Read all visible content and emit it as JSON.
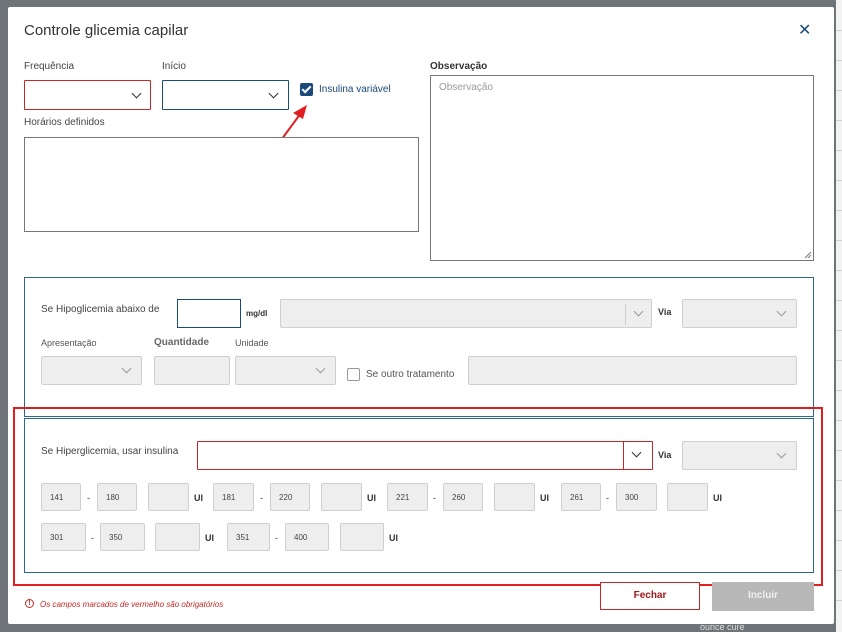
{
  "dialog": {
    "title": "Controle glicemia capilar",
    "close_icon": "close-icon"
  },
  "form": {
    "frequencia_label": "Frequência",
    "frequencia_value": "",
    "inicio_label": "Início",
    "inicio_value": "",
    "insulina_variavel_label": "Insulina variável",
    "insulina_variavel_checked": true,
    "horarios_label": "Horários definidos",
    "horarios_value": "",
    "observacao_label": "Observação",
    "observacao_placeholder": "Observação",
    "observacao_value": ""
  },
  "hipoglicemia": {
    "label": "Se Hipoglicemia abaixo de",
    "value": "",
    "unit": "mg/dl",
    "via_label": "Via",
    "apresentacao_label": "Apresentação",
    "quantidade_label": "Quantidade",
    "unidade_label": "Unidade",
    "outro_tratamento_label": "Se outro tratamento",
    "outro_tratamento_checked": false
  },
  "hiperglicemia": {
    "label": "Se Hiperglicemia, usar insulina",
    "insulina_value": "",
    "via_label": "Via",
    "unit_label": "UI",
    "dash": "-",
    "ranges": [
      {
        "min": "141",
        "max": "180",
        "ui": ""
      },
      {
        "min": "181",
        "max": "220",
        "ui": ""
      },
      {
        "min": "221",
        "max": "260",
        "ui": ""
      },
      {
        "min": "261",
        "max": "300",
        "ui": ""
      },
      {
        "min": "301",
        "max": "350",
        "ui": ""
      },
      {
        "min": "351",
        "max": "400",
        "ui": ""
      }
    ]
  },
  "footer": {
    "required_note": "Os campos marcados de vermelho são obrigatórios",
    "fechar_label": "Fechar",
    "incluir_label": "Incluir"
  },
  "background": {
    "bottom_text": "ounce cure"
  },
  "colors": {
    "primary": "#1a4a7a",
    "required": "#c62828",
    "annotation": "#e02020"
  }
}
